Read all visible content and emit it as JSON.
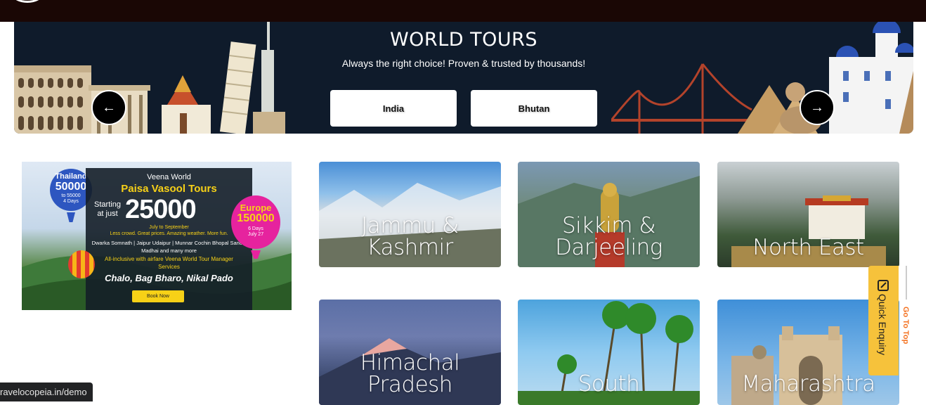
{
  "banner": {
    "title": "WORLD TOURS",
    "subtitle": "Always the right choice! Proven & trusted by thousands!",
    "tabs": [
      {
        "label": "India"
      },
      {
        "label": "Bhutan"
      }
    ],
    "prev_icon": "←",
    "next_icon": "→"
  },
  "promo": {
    "brand": "Veena World",
    "headline": "Paisa Vasool Tours",
    "starting_text": "Starting at just",
    "price": "25000",
    "dates": "July to September",
    "tagline": "Less crowd. Great prices. Amazing weather. More fun.",
    "routes": "Dwarka Somnath | Jaipur Udaipur | Munnar Cochin Bhopal Sanchi Madhai and many more",
    "inclusive": "All-inclusive with airfare Veena World Tour Manager Services",
    "slogan": "Chalo, Bag Bharo, Nikal Pado",
    "cta": "Book Now",
    "balloon_left": {
      "title": "Thailand",
      "price": "50000",
      "range": "to 55000",
      "days": "4 Days"
    },
    "balloon_right": {
      "title": "Europe",
      "price": "150000",
      "days": "6 Days",
      "date": "July 27"
    }
  },
  "destinations": [
    {
      "name": "Jammu & Kashmir"
    },
    {
      "name": "Sikkim & Darjeeling"
    },
    {
      "name": "North East"
    },
    {
      "name": "Himachal Pradesh"
    },
    {
      "name": "South"
    },
    {
      "name": "Maharashtra"
    }
  ],
  "widgets": {
    "quick_enquiry": "Quick Enquiry",
    "go_to_top": "Go To Top"
  },
  "status_bar": {
    "url": "ravelocopeia.in/demo"
  },
  "colors": {
    "topbar": "#1a0705",
    "banner": "#0f1b2b",
    "enquiry": "#f6c23b",
    "gototop": "#f4711f"
  }
}
